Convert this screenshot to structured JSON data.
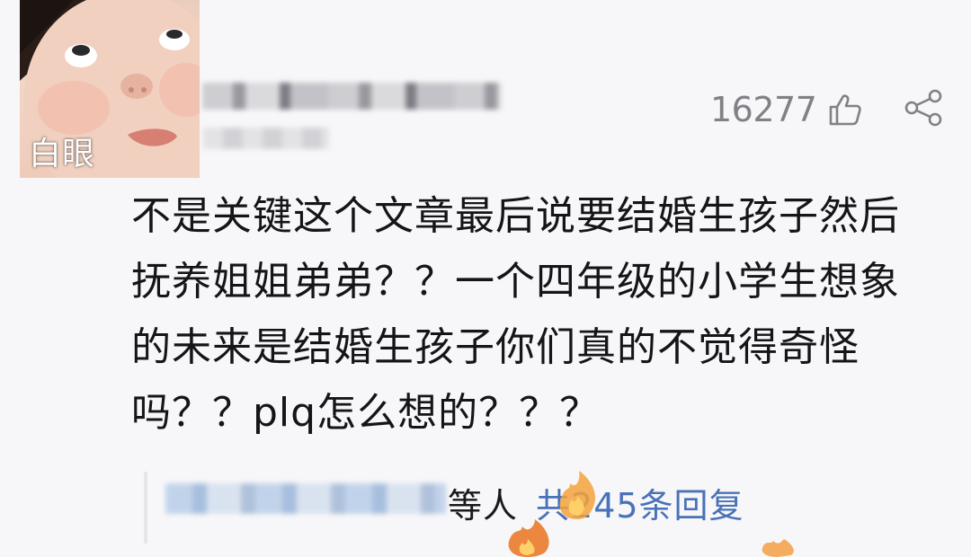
{
  "avatar": {
    "caption": "白眼"
  },
  "stats": {
    "like_count": "16277"
  },
  "comment": {
    "lines": [
      "不是关键这个文章最后说要结婚生孩子然后",
      "抚养姐姐弟弟？？一个四年级的小学生想象",
      "的未来是结婚生孩子你们真的不觉得奇怪",
      "吗？？plq怎么想的？？？"
    ]
  },
  "replies": {
    "suffix": "等人",
    "link": "共245条回复"
  },
  "icons": {
    "like": "thumbs-up-icon",
    "share": "share-icon"
  },
  "colors": {
    "link": "#4a72b8",
    "muted": "#808086",
    "text": "#151518"
  }
}
